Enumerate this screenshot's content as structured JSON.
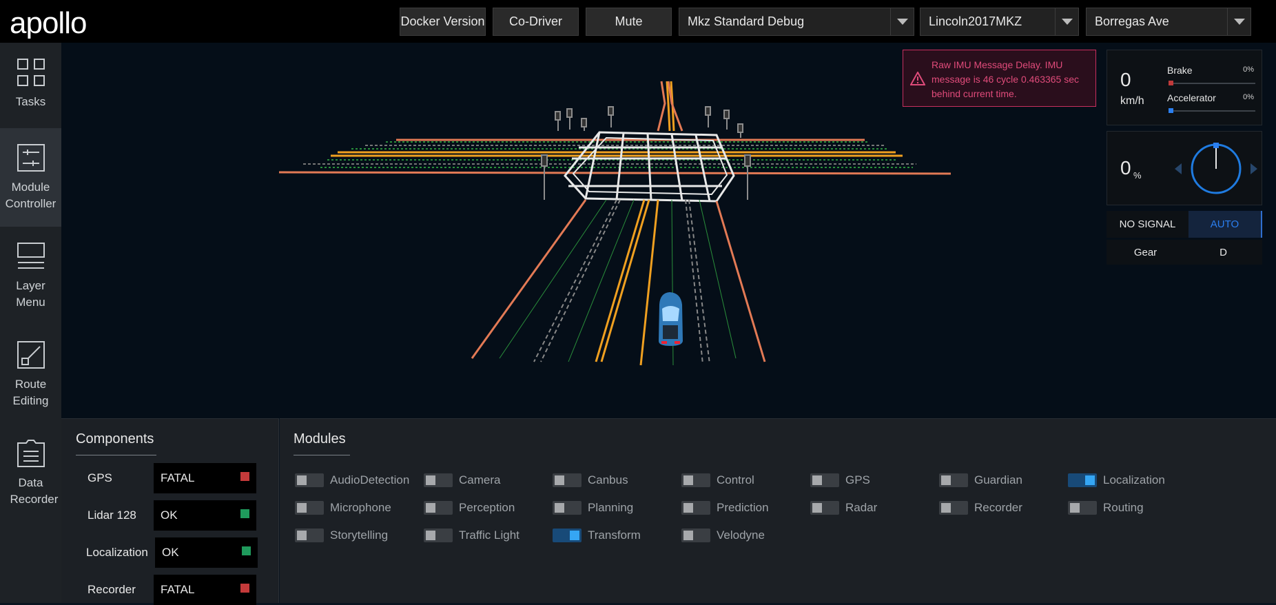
{
  "app": {
    "logo_text": "apollo"
  },
  "toolbar": {
    "docker_version": "Docker Version",
    "co_driver": "Co-Driver",
    "mute": "Mute",
    "mode_select": "Mkz Standard Debug",
    "vehicle_select": "Lincoln2017MKZ",
    "map_select": "Borregas Ave"
  },
  "sidebar": {
    "items": [
      {
        "label": "Tasks",
        "icon": "grid-icon",
        "active": false
      },
      {
        "label": "Module Controller",
        "icon": "sliders-icon",
        "active": true
      },
      {
        "label": "Layer Menu",
        "icon": "layers-icon",
        "active": false
      },
      {
        "label": "Route Editing",
        "icon": "route-icon",
        "active": false
      },
      {
        "label": "Data Recorder",
        "icon": "document-icon",
        "active": false
      }
    ]
  },
  "alert": {
    "icon": "warning-triangle-icon",
    "message": "Raw IMU Message Delay. IMU message is 46 cycle 0.463365 sec behind current time.",
    "color": "#c92f5f"
  },
  "dashboard": {
    "speed": "0",
    "speed_unit": "km/h",
    "brake_label": "Brake",
    "brake_value": "0%",
    "brake_level": 0,
    "brake_color": "#c03a3a",
    "accelerator_label": "Accelerator",
    "accelerator_value": "0%",
    "accelerator_level": 0,
    "accelerator_color": "#2b7ff0",
    "steering_value": "0",
    "steering_unit": "%",
    "signal_none": "NO SIGNAL",
    "signal_auto": "AUTO",
    "gear_label": "Gear",
    "gear_value": "D"
  },
  "components": {
    "title": "Components",
    "items": [
      {
        "name": "GPS",
        "status": "FATAL",
        "color": "#c43a3a"
      },
      {
        "name": "Lidar 128",
        "status": "OK",
        "color": "#1f9a5c"
      },
      {
        "name": "Localization",
        "status": "OK",
        "color": "#1f9a5c"
      },
      {
        "name": "Recorder",
        "status": "FATAL",
        "color": "#c43a3a"
      }
    ]
  },
  "modules": {
    "title": "Modules",
    "items": [
      {
        "label": "AudioDetection",
        "on": false
      },
      {
        "label": "Camera",
        "on": false
      },
      {
        "label": "Canbus",
        "on": false
      },
      {
        "label": "Control",
        "on": false
      },
      {
        "label": "GPS",
        "on": false
      },
      {
        "label": "Guardian",
        "on": false
      },
      {
        "label": "Localization",
        "on": true
      },
      {
        "label": "Microphone",
        "on": false
      },
      {
        "label": "Perception",
        "on": false
      },
      {
        "label": "Planning",
        "on": false
      },
      {
        "label": "Prediction",
        "on": false
      },
      {
        "label": "Radar",
        "on": false
      },
      {
        "label": "Recorder",
        "on": false
      },
      {
        "label": "Routing",
        "on": false
      },
      {
        "label": "Storytelling",
        "on": false
      },
      {
        "label": "Traffic Light",
        "on": false
      },
      {
        "label": "Transform",
        "on": true
      },
      {
        "label": "Velodyne",
        "on": false
      }
    ]
  }
}
